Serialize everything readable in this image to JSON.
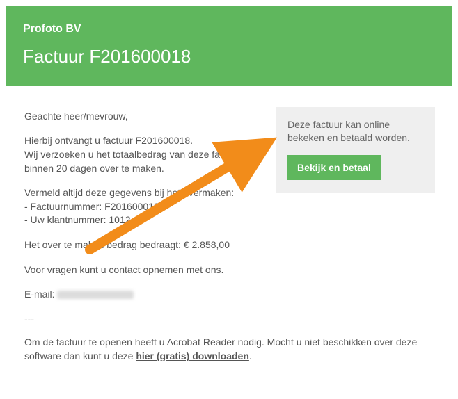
{
  "header": {
    "company": "Profoto BV",
    "title": "Factuur F201600018"
  },
  "sidebar": {
    "info": "Deze factuur kan online bekeken en betaald worden.",
    "cta_label": "Bekijk en betaal"
  },
  "body": {
    "salutation": "Geachte heer/mevrouw,",
    "line1": "Hierbij ontvangt u factuur F201600018.",
    "line2": "Wij verzoeken u het totaalbedrag van deze factuur binnen 20 dagen over te maken.",
    "details_intro": "Vermeld altijd deze gegevens bij het overmaken:",
    "detail_invoice": "- Factuurnummer: F201600018",
    "detail_client": "- Uw klantnummer: 1012",
    "amount_line": "Het over te maken bedrag bedraagt: € 2.858,00",
    "contact_line": "Voor vragen kunt u contact opnemen met ons.",
    "email_label": "E-mail: ",
    "separator": "---",
    "footnote_pre": "Om de factuur te openen heeft u Acrobat Reader nodig. Mocht u niet beschikken over deze software dan kunt u deze ",
    "footnote_link": "hier (gratis) downloaden",
    "footnote_post": "."
  }
}
